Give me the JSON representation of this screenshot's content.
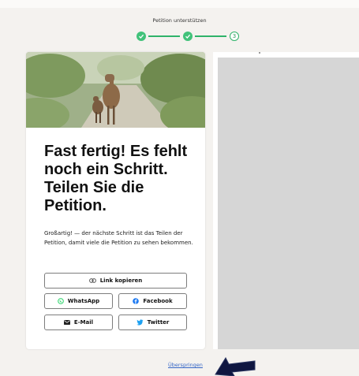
{
  "header": {
    "title": "Petition unterstützen"
  },
  "stepper": {
    "steps": [
      {
        "state": "done"
      },
      {
        "state": "done"
      },
      {
        "state": "current",
        "label": "3"
      }
    ],
    "accent": "#2fb36a"
  },
  "card": {
    "heading": "Fast fertig! Es fehlt noch ein Schritt. Teilen Sie die Petition.",
    "body": "Großartig! — der nächste Schritt ist das Teilen der Petition, damit viele die Petition zu sehen bekommen.",
    "buttons": {
      "copy_link": "Link kopieren",
      "whatsapp": "WhatsApp",
      "facebook": "Facebook",
      "email": "E-Mail",
      "twitter": "Twitter"
    }
  },
  "footer": {
    "skip": "Überspringen"
  },
  "colors": {
    "whatsapp": "#25d366",
    "facebook": "#1877f2",
    "twitter": "#1da1f2",
    "link": "#3566c6"
  }
}
